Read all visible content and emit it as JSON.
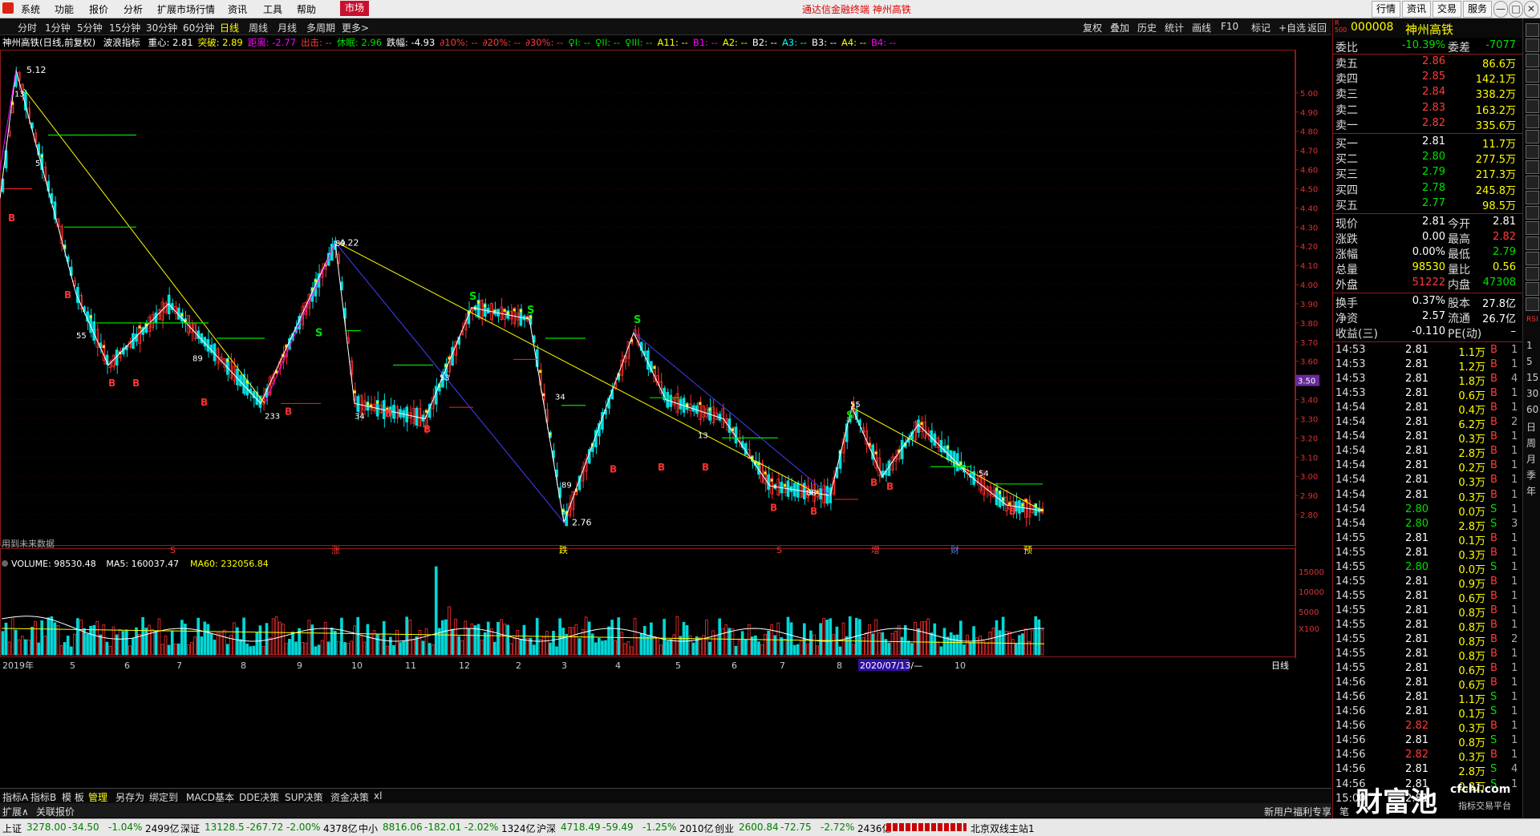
{
  "menubar": {
    "items": [
      "系统",
      "功能",
      "报价",
      "分析",
      "扩展市场行情",
      "资讯",
      "工具",
      "帮助"
    ],
    "market_label": "市场",
    "center_title": "通达信金融终端  神州高铁",
    "right_buttons": [
      "行情",
      "资讯",
      "交易",
      "服务"
    ],
    "window_buttons": [
      "—",
      "□",
      "✕"
    ]
  },
  "periodbar": {
    "periods": [
      "分时",
      "1分钟",
      "5分钟",
      "15分钟",
      "30分钟",
      "60分钟",
      "日线",
      "周线",
      "月线",
      "多周期",
      "更多>"
    ],
    "active": "日线",
    "right": [
      "复权",
      "叠加",
      "历史",
      "统计",
      "画线",
      "F10",
      "标记",
      "+自选",
      "返回"
    ]
  },
  "info": {
    "stock": "神州高铁(日线,前复权)",
    "indicator": "波浪指标",
    "items": [
      {
        "t": "重心: 2.81",
        "c": "wht"
      },
      {
        "t": "突破: 2.89",
        "c": "yel"
      },
      {
        "t": "距离: -2.77",
        "c": "mag"
      },
      {
        "t": "出击: --",
        "c": "red"
      },
      {
        "t": "休眠: 2.96",
        "c": "grn"
      },
      {
        "t": "跌幅: -4.93",
        "c": "wht"
      },
      {
        "t": "∂10%: --",
        "c": "red"
      },
      {
        "t": "∂20%: --",
        "c": "red"
      },
      {
        "t": "∂30%: --",
        "c": "red"
      },
      {
        "t": "♀I: --",
        "c": "grn"
      },
      {
        "t": "♀II: --",
        "c": "grn"
      },
      {
        "t": "♀III: --",
        "c": "grn"
      },
      {
        "t": "A11: --",
        "c": "yel"
      },
      {
        "t": "B1: --",
        "c": "mag"
      },
      {
        "t": "A2: --",
        "c": "yel"
      },
      {
        "t": "B2: --",
        "c": "wht"
      },
      {
        "t": "A3: --",
        "c": "cya"
      },
      {
        "t": "B3: --",
        "c": "wht"
      },
      {
        "t": "A4: --",
        "c": "yel"
      },
      {
        "t": "B4: --",
        "c": "mag"
      }
    ],
    "volume_line": [
      {
        "t": "VOLUME: 98530.48",
        "c": "wht"
      },
      {
        "t": "MA5: 160037.47",
        "c": "wht"
      },
      {
        "t": "MA60: 232056.84",
        "c": "yel"
      }
    ],
    "future_note": "用到未来数据",
    "period_label": "日线",
    "date_tag": "2020/07/13/—",
    "price_tag": "3.50"
  },
  "chart_data": {
    "type": "candlestick",
    "title": "神州高铁(日线,前复权)",
    "ylim": [
      2.7,
      5.15
    ],
    "price_ticks": [
      "5.00",
      "4.90",
      "4.80",
      "4.70",
      "4.60",
      "4.50",
      "4.40",
      "4.30",
      "4.20",
      "4.10",
      "4.00",
      "3.90",
      "3.80",
      "3.70",
      "3.60",
      "3.50",
      "3.40",
      "3.30",
      "3.20",
      "3.10",
      "3.00",
      "2.90",
      "2.80"
    ],
    "volume_ticks": [
      "15000",
      "10000",
      "5000",
      "X100"
    ],
    "month_labels": [
      "2019年",
      "5",
      "6",
      "7",
      "8",
      "9",
      "10",
      "11",
      "12",
      "2",
      "3",
      "4",
      "5",
      "6",
      "7",
      "8",
      "9",
      "10"
    ],
    "annotations": [
      {
        "text": "5.12",
        "price": 5.12
      },
      {
        "text": "4.22",
        "price": 4.22
      },
      {
        "text": "2.76",
        "price": 2.76
      }
    ],
    "event_labels": [
      "S",
      "涨",
      "跌",
      "S",
      "增",
      "财",
      "预"
    ],
    "wave_path": [
      [
        0,
        4.45
      ],
      [
        20,
        5.12
      ],
      [
        95,
        3.95
      ],
      [
        135,
        3.58
      ],
      [
        210,
        3.9
      ],
      [
        325,
        3.38
      ],
      [
        418,
        4.22
      ],
      [
        442,
        3.38
      ],
      [
        530,
        3.3
      ],
      [
        588,
        3.88
      ],
      [
        660,
        3.82
      ],
      [
        703,
        2.76
      ],
      [
        790,
        3.75
      ],
      [
        830,
        3.4
      ],
      [
        902,
        3.3
      ],
      [
        960,
        2.95
      ],
      [
        1035,
        2.9
      ],
      [
        1062,
        3.36
      ],
      [
        1100,
        3.0
      ],
      [
        1145,
        3.27
      ],
      [
        1210,
        3.0
      ],
      [
        1255,
        2.85
      ],
      [
        1300,
        2.82
      ]
    ],
    "close_series_sample": [
      4.45,
      4.8,
      5.0,
      4.7,
      4.35,
      4.0,
      3.85,
      3.7,
      3.6,
      3.75,
      3.8,
      3.7,
      3.55,
      3.45,
      3.4,
      3.48,
      3.6,
      3.75,
      3.95,
      4.1,
      3.6,
      3.45,
      3.55,
      3.5,
      3.4,
      3.35,
      3.55,
      3.7,
      3.85,
      3.75,
      3.7,
      3.6,
      3.3,
      3.0,
      2.85,
      3.15,
      3.35,
      3.5,
      3.7,
      3.55,
      3.35,
      3.25,
      3.22,
      3.2,
      3.15,
      3.1,
      3.0,
      2.95,
      2.95,
      3.2,
      3.3,
      3.15,
      3.1,
      3.2,
      3.25,
      3.1,
      3.05,
      3.0,
      2.92,
      2.85,
      2.81
    ]
  },
  "panel": {
    "code": "000008",
    "name": "神州高铁",
    "weibi_label": "委比",
    "weibi": "-10.39%",
    "weicha_label": "委差",
    "weicha": "-7077",
    "asks": [
      {
        "l": "卖五",
        "p": "2.86",
        "v": "86.6万"
      },
      {
        "l": "卖四",
        "p": "2.85",
        "v": "142.1万"
      },
      {
        "l": "卖三",
        "p": "2.84",
        "v": "338.2万"
      },
      {
        "l": "卖二",
        "p": "2.83",
        "v": "163.2万"
      },
      {
        "l": "卖一",
        "p": "2.82",
        "v": "335.6万"
      }
    ],
    "bids": [
      {
        "l": "买一",
        "p": "2.81",
        "v": "11.7万"
      },
      {
        "l": "买二",
        "p": "2.80",
        "v": "277.5万"
      },
      {
        "l": "买三",
        "p": "2.79",
        "v": "217.3万"
      },
      {
        "l": "买四",
        "p": "2.78",
        "v": "245.8万"
      },
      {
        "l": "买五",
        "p": "2.77",
        "v": "98.5万"
      }
    ],
    "stats": [
      {
        "l": "现价",
        "v": "2.81",
        "c": "wht",
        "l2": "今开",
        "v2": "2.81",
        "c2": "wht"
      },
      {
        "l": "涨跌",
        "v": "0.00",
        "c": "wht",
        "l2": "最高",
        "v2": "2.82",
        "c2": "red"
      },
      {
        "l": "涨幅",
        "v": "0.00%",
        "c": "wht",
        "l2": "最低",
        "v2": "2.79",
        "c2": "grn"
      },
      {
        "l": "总量",
        "v": "98530",
        "c": "yel",
        "l2": "量比",
        "v2": "0.56",
        "c2": "yel"
      },
      {
        "l": "外盘",
        "v": "51222",
        "c": "red",
        "l2": "内盘",
        "v2": "47308",
        "c2": "grn"
      }
    ],
    "stats2": [
      {
        "l": "换手",
        "v": "0.37%",
        "c": "wht",
        "l2": "股本",
        "v2": "27.8亿",
        "c2": "wht"
      },
      {
        "l": "净资",
        "v": "2.57",
        "c": "wht",
        "l2": "流通",
        "v2": "26.7亿",
        "c2": "wht"
      },
      {
        "l": "收益(三)",
        "v": "-0.110",
        "c": "wht",
        "l2": "PE(动)",
        "v2": "–",
        "c2": "wht"
      }
    ],
    "ticks": [
      {
        "t": "14:53",
        "p": "2.81",
        "v": "1.1万",
        "bs": "B",
        "n": "1"
      },
      {
        "t": "14:53",
        "p": "2.81",
        "v": "1.2万",
        "bs": "B",
        "n": "1"
      },
      {
        "t": "14:53",
        "p": "2.81",
        "v": "1.8万",
        "bs": "B",
        "n": "4"
      },
      {
        "t": "14:53",
        "p": "2.81",
        "v": "0.6万",
        "bs": "B",
        "n": "1"
      },
      {
        "t": "14:54",
        "p": "2.81",
        "v": "0.4万",
        "bs": "B",
        "n": "1"
      },
      {
        "t": "14:54",
        "p": "2.81",
        "v": "6.2万",
        "bs": "B",
        "n": "2"
      },
      {
        "t": "14:54",
        "p": "2.81",
        "v": "0.3万",
        "bs": "B",
        "n": "1"
      },
      {
        "t": "14:54",
        "p": "2.81",
        "v": "2.8万",
        "bs": "B",
        "n": "1"
      },
      {
        "t": "14:54",
        "p": "2.81",
        "v": "0.2万",
        "bs": "B",
        "n": "1"
      },
      {
        "t": "14:54",
        "p": "2.81",
        "v": "0.3万",
        "bs": "B",
        "n": "1"
      },
      {
        "t": "14:54",
        "p": "2.81",
        "v": "0.3万",
        "bs": "B",
        "n": "1"
      },
      {
        "t": "14:54",
        "p": "2.80",
        "v": "0.0万",
        "bs": "S",
        "n": "1"
      },
      {
        "t": "14:54",
        "p": "2.80",
        "v": "2.8万",
        "bs": "S",
        "n": "3"
      },
      {
        "t": "14:55",
        "p": "2.81",
        "v": "0.1万",
        "bs": "B",
        "n": "1"
      },
      {
        "t": "14:55",
        "p": "2.81",
        "v": "0.3万",
        "bs": "B",
        "n": "1"
      },
      {
        "t": "14:55",
        "p": "2.80",
        "v": "0.0万",
        "bs": "S",
        "n": "1"
      },
      {
        "t": "14:55",
        "p": "2.81",
        "v": "0.9万",
        "bs": "B",
        "n": "1"
      },
      {
        "t": "14:55",
        "p": "2.81",
        "v": "0.6万",
        "bs": "B",
        "n": "1"
      },
      {
        "t": "14:55",
        "p": "2.81",
        "v": "0.8万",
        "bs": "B",
        "n": "1"
      },
      {
        "t": "14:55",
        "p": "2.81",
        "v": "0.8万",
        "bs": "B",
        "n": "1"
      },
      {
        "t": "14:55",
        "p": "2.81",
        "v": "0.8万",
        "bs": "B",
        "n": "2"
      },
      {
        "t": "14:55",
        "p": "2.81",
        "v": "0.8万",
        "bs": "B",
        "n": "1"
      },
      {
        "t": "14:55",
        "p": "2.81",
        "v": "0.6万",
        "bs": "B",
        "n": "1"
      },
      {
        "t": "14:56",
        "p": "2.81",
        "v": "0.6万",
        "bs": "B",
        "n": "1"
      },
      {
        "t": "14:56",
        "p": "2.81",
        "v": "1.1万",
        "bs": "S",
        "n": "1"
      },
      {
        "t": "14:56",
        "p": "2.81",
        "v": "0.1万",
        "bs": "S",
        "n": "1"
      },
      {
        "t": "14:56",
        "p": "2.82",
        "v": "0.3万",
        "bs": "B",
        "n": "1"
      },
      {
        "t": "14:56",
        "p": "2.81",
        "v": "0.8万",
        "bs": "S",
        "n": "1"
      },
      {
        "t": "14:56",
        "p": "2.82",
        "v": "0.3万",
        "bs": "B",
        "n": "1"
      },
      {
        "t": "14:56",
        "p": "2.81",
        "v": "2.8万",
        "bs": "S",
        "n": "4"
      },
      {
        "t": "14:56",
        "p": "2.81",
        "v": "0.8万",
        "bs": "S",
        "n": "1"
      },
      {
        "t": "15:00",
        "p": "2.81",
        "v": "",
        "bs": "",
        "n": ""
      }
    ]
  },
  "strip": {
    "labels": [
      "RSI",
      "1",
      "5",
      "15",
      "30",
      "60",
      "日",
      "周",
      "月",
      "季",
      "年"
    ]
  },
  "bottombar": {
    "tabs": [
      "指标A",
      "指标B",
      "模 板",
      "管理",
      "另存为",
      "绑定到",
      "MACD基本",
      "DDE决策",
      "SUP决策",
      "资金决策",
      "xl"
    ],
    "active": "管理"
  },
  "extbar": {
    "left": [
      "扩展∧",
      "关联报价"
    ],
    "right": "新用户福利专享",
    "right2": "笔"
  },
  "statusbar": {
    "items": [
      {
        "name": "上证",
        "val": "3278.00",
        "chg": "-34.50",
        "pct": "-1.04%",
        "amt": "2499亿"
      },
      {
        "name": "深证",
        "val": "13128.5",
        "chg": "-267.72",
        "pct": "-2.00%",
        "amt": "4378亿"
      },
      {
        "name": "中小",
        "val": "8816.06",
        "chg": "-182.01",
        "pct": "-2.02%",
        "amt": "1324亿"
      },
      {
        "name": "沪深",
        "val": "4718.49",
        "chg": "-59.49",
        "pct": "-1.25%",
        "amt": "2010亿"
      },
      {
        "name": "创业",
        "val": "2600.84",
        "chg": "-72.75",
        "pct": "-2.72%",
        "amt": "2436亿"
      }
    ],
    "server": "北京双线主站1"
  },
  "watermark": {
    "brand": "财富池",
    "site": "cfchi.com",
    "sub": "指标交易平台"
  }
}
